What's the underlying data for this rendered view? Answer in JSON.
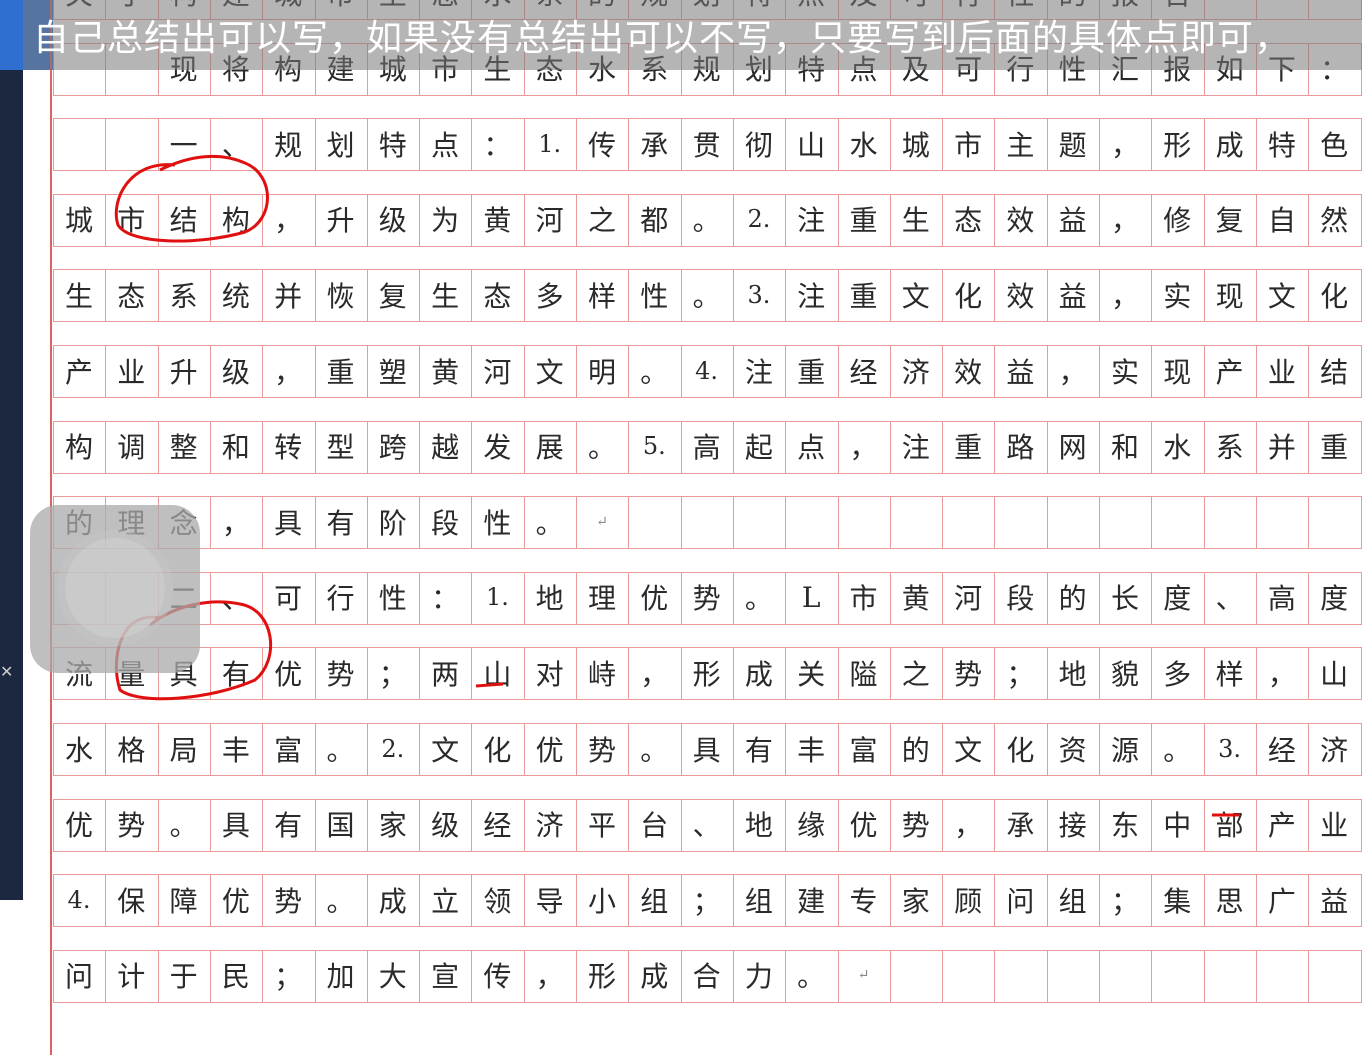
{
  "subtitle": "自己总结出可以写，如果没有总结出可以不写，只要写到后面的具体点即可，",
  "left_tab_glyph": "，",
  "rows": [
    [
      "关",
      "于",
      "构",
      "建",
      "城",
      "市",
      "生",
      "态",
      "水",
      "系",
      "的",
      "规",
      "划",
      "特",
      "点",
      "及",
      "可",
      "行",
      "性",
      "的",
      "报",
      "告",
      "",
      ""
    ],
    [
      "",
      "",
      "现",
      "将",
      "构",
      "建",
      "城",
      "市",
      "生",
      "态",
      "水",
      "系",
      "规",
      "划",
      "特",
      "点",
      "及",
      "可",
      "行",
      "性",
      "汇",
      "报",
      "如",
      "下",
      "："
    ],
    [
      "",
      "",
      "一",
      "、",
      "规",
      "划",
      "特",
      "点",
      "：",
      "1.",
      "传",
      "承",
      "贯",
      "彻",
      "山",
      "水",
      "城",
      "市",
      "主",
      "题",
      "，",
      "形",
      "成",
      "特",
      "色"
    ],
    [
      "城",
      "市",
      "结",
      "构",
      "，",
      "升",
      "级",
      "为",
      "黄",
      "河",
      "之",
      "都",
      "。",
      "2.",
      "注",
      "重",
      "生",
      "态",
      "效",
      "益",
      "，",
      "修",
      "复",
      "自",
      "然"
    ],
    [
      "生",
      "态",
      "系",
      "统",
      "并",
      "恢",
      "复",
      "生",
      "态",
      "多",
      "样",
      "性",
      "。",
      "3.",
      "注",
      "重",
      "文",
      "化",
      "效",
      "益",
      "，",
      "实",
      "现",
      "文",
      "化"
    ],
    [
      "产",
      "业",
      "升",
      "级",
      "，",
      "重",
      "塑",
      "黄",
      "河",
      "文",
      "明",
      "。",
      "4.",
      "注",
      "重",
      "经",
      "济",
      "效",
      "益",
      "，",
      "实",
      "现",
      "产",
      "业",
      "结"
    ],
    [
      "构",
      "调",
      "整",
      "和",
      "转",
      "型",
      "跨",
      "越",
      "发",
      "展",
      "。",
      "5.",
      "高",
      "起",
      "点",
      "，",
      "注",
      "重",
      "路",
      "网",
      "和",
      "水",
      "系",
      "并",
      "重"
    ],
    [
      "的",
      "理",
      "念",
      "，",
      "具",
      "有",
      "阶",
      "段",
      "性",
      "。",
      "↵",
      "",
      "",
      "",
      "",
      "",
      "",
      "",
      "",
      "",
      "",
      "",
      "",
      "",
      ""
    ],
    [
      "",
      "",
      "二",
      "、",
      "可",
      "行",
      "性",
      "：",
      "1.",
      "地",
      "理",
      "优",
      "势",
      "。",
      "L",
      "市",
      "黄",
      "河",
      "段",
      "的",
      "长",
      "度",
      "、",
      "高",
      "度"
    ],
    [
      "流",
      "量",
      "具",
      "有",
      "优",
      "势",
      "；",
      "两",
      "山",
      "对",
      "峙",
      "，",
      "形",
      "成",
      "关",
      "隘",
      "之",
      "势",
      "；",
      "地",
      "貌",
      "多",
      "样",
      "，",
      "山"
    ],
    [
      "水",
      "格",
      "局",
      "丰",
      "富",
      "。",
      "2.",
      "文",
      "化",
      "优",
      "势",
      "。",
      "具",
      "有",
      "丰",
      "富",
      "的",
      "文",
      "化",
      "资",
      "源",
      "。",
      "3.",
      "经",
      "济"
    ],
    [
      "优",
      "势",
      "。",
      "具",
      "有",
      "国",
      "家",
      "级",
      "经",
      "济",
      "平",
      "台",
      "、",
      "地",
      "缘",
      "优",
      "势",
      "，",
      "承",
      "接",
      "东",
      "中",
      "部",
      "产",
      "业"
    ],
    [
      "4.",
      "保",
      "障",
      "优",
      "势",
      "。",
      "成",
      "立",
      "领",
      "导",
      "小",
      "组",
      "；",
      "组",
      "建",
      "专",
      "家",
      "顾",
      "问",
      "组",
      "；",
      "集",
      "思",
      "广",
      "益"
    ],
    [
      "问",
      "计",
      "于",
      "民",
      "；",
      "加",
      "大",
      "宣",
      "传",
      "，",
      "形",
      "成",
      "合",
      "力",
      "。",
      "↵",
      "",
      "",
      "",
      "",
      "",
      "",
      "",
      "",
      ""
    ]
  ],
  "colors": {
    "grid": "#e89a9a",
    "annotation_red": "#e01010",
    "subtitle_bg": "rgba(120,120,120,0.55)"
  }
}
